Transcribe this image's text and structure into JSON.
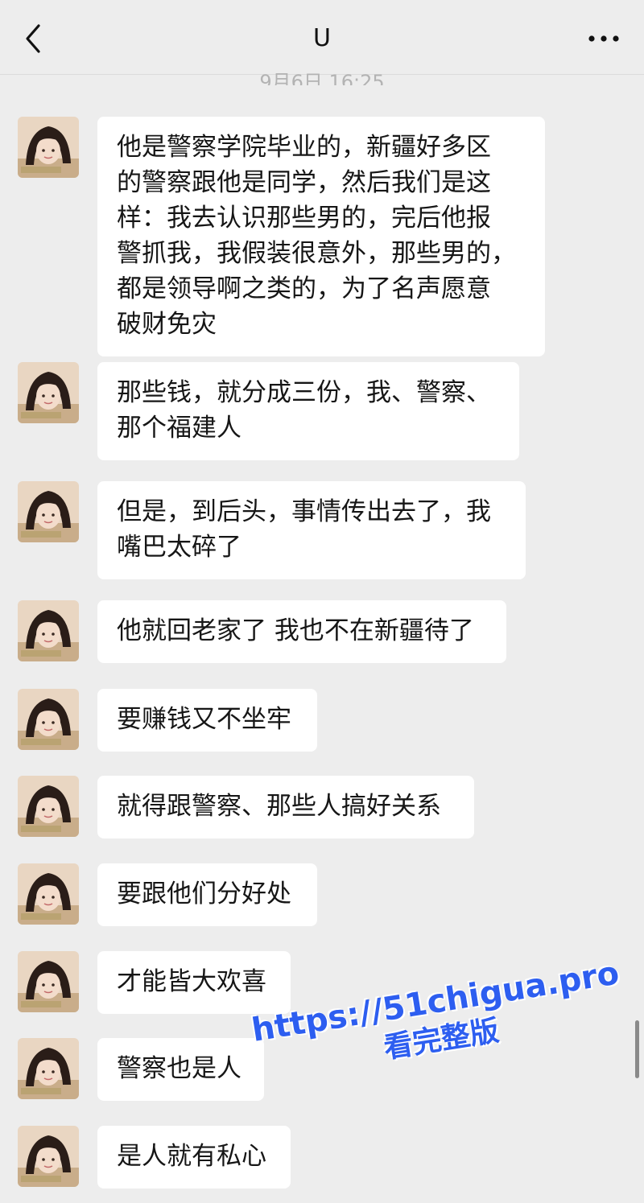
{
  "header": {
    "title": "U",
    "back_icon": "chevron-left-icon",
    "more_icon": "ellipsis-icon"
  },
  "timestamp": "9月6日 16:25",
  "messages": [
    {
      "text": "他是警察学院毕业的，新疆好多区\n的警察跟他是同学，然后我们是这\n样：我去认识那些男的，完后他报\n警抓我，我假装很意外，那些男的，\n都是领导啊之类的，为了名声愿意\n破财免灾"
    },
    {
      "text": "那些钱，就分成三份，我、警察、\n那个福建人"
    },
    {
      "text": "但是，到后头，事情传出去了，我\n嘴巴太碎了"
    },
    {
      "text": "他就回老家了 我也不在新疆待了"
    },
    {
      "text": "要赚钱又不坐牢"
    },
    {
      "text": "就得跟警察、那些人搞好关系"
    },
    {
      "text": "要跟他们分好处"
    },
    {
      "text": "才能皆大欢喜"
    },
    {
      "text": "警察也是人"
    },
    {
      "text": "是人就有私心"
    }
  ],
  "watermark": {
    "line1": "https://51chigua.pro",
    "line2": "看完整版"
  }
}
